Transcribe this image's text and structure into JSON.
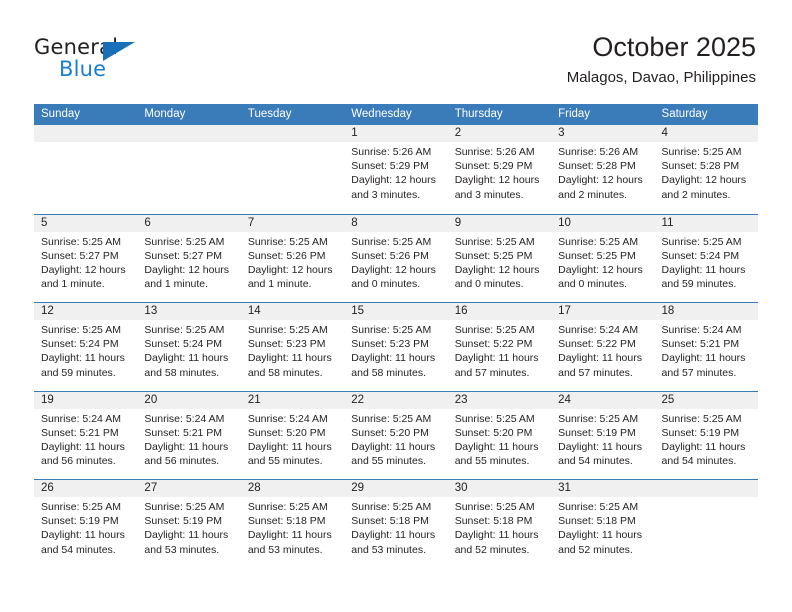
{
  "brand": {
    "name_part1": "General",
    "name_part2": "Blue",
    "triangle_icon": "triangle-icon",
    "color_dark": "#231f20",
    "color_blue": "#1a7fd4"
  },
  "header": {
    "title": "October 2025",
    "subtitle": "Malagos, Davao, Philippines"
  },
  "calendar": {
    "accent_color": "#3a7cba",
    "daynum_bg": "#f0f0f0",
    "weekday_headers": [
      "Sunday",
      "Monday",
      "Tuesday",
      "Wednesday",
      "Thursday",
      "Friday",
      "Saturday"
    ],
    "weeks": [
      [
        {
          "day": "",
          "sunrise": "",
          "sunset": "",
          "daylight_line1": "",
          "daylight_line2": ""
        },
        {
          "day": "",
          "sunrise": "",
          "sunset": "",
          "daylight_line1": "",
          "daylight_line2": ""
        },
        {
          "day": "",
          "sunrise": "",
          "sunset": "",
          "daylight_line1": "",
          "daylight_line2": ""
        },
        {
          "day": "1",
          "sunrise": "Sunrise: 5:26 AM",
          "sunset": "Sunset: 5:29 PM",
          "daylight_line1": "Daylight: 12 hours",
          "daylight_line2": "and 3 minutes."
        },
        {
          "day": "2",
          "sunrise": "Sunrise: 5:26 AM",
          "sunset": "Sunset: 5:29 PM",
          "daylight_line1": "Daylight: 12 hours",
          "daylight_line2": "and 3 minutes."
        },
        {
          "day": "3",
          "sunrise": "Sunrise: 5:26 AM",
          "sunset": "Sunset: 5:28 PM",
          "daylight_line1": "Daylight: 12 hours",
          "daylight_line2": "and 2 minutes."
        },
        {
          "day": "4",
          "sunrise": "Sunrise: 5:25 AM",
          "sunset": "Sunset: 5:28 PM",
          "daylight_line1": "Daylight: 12 hours",
          "daylight_line2": "and 2 minutes."
        }
      ],
      [
        {
          "day": "5",
          "sunrise": "Sunrise: 5:25 AM",
          "sunset": "Sunset: 5:27 PM",
          "daylight_line1": "Daylight: 12 hours",
          "daylight_line2": "and 1 minute."
        },
        {
          "day": "6",
          "sunrise": "Sunrise: 5:25 AM",
          "sunset": "Sunset: 5:27 PM",
          "daylight_line1": "Daylight: 12 hours",
          "daylight_line2": "and 1 minute."
        },
        {
          "day": "7",
          "sunrise": "Sunrise: 5:25 AM",
          "sunset": "Sunset: 5:26 PM",
          "daylight_line1": "Daylight: 12 hours",
          "daylight_line2": "and 1 minute."
        },
        {
          "day": "8",
          "sunrise": "Sunrise: 5:25 AM",
          "sunset": "Sunset: 5:26 PM",
          "daylight_line1": "Daylight: 12 hours",
          "daylight_line2": "and 0 minutes."
        },
        {
          "day": "9",
          "sunrise": "Sunrise: 5:25 AM",
          "sunset": "Sunset: 5:25 PM",
          "daylight_line1": "Daylight: 12 hours",
          "daylight_line2": "and 0 minutes."
        },
        {
          "day": "10",
          "sunrise": "Sunrise: 5:25 AM",
          "sunset": "Sunset: 5:25 PM",
          "daylight_line1": "Daylight: 12 hours",
          "daylight_line2": "and 0 minutes."
        },
        {
          "day": "11",
          "sunrise": "Sunrise: 5:25 AM",
          "sunset": "Sunset: 5:24 PM",
          "daylight_line1": "Daylight: 11 hours",
          "daylight_line2": "and 59 minutes."
        }
      ],
      [
        {
          "day": "12",
          "sunrise": "Sunrise: 5:25 AM",
          "sunset": "Sunset: 5:24 PM",
          "daylight_line1": "Daylight: 11 hours",
          "daylight_line2": "and 59 minutes."
        },
        {
          "day": "13",
          "sunrise": "Sunrise: 5:25 AM",
          "sunset": "Sunset: 5:24 PM",
          "daylight_line1": "Daylight: 11 hours",
          "daylight_line2": "and 58 minutes."
        },
        {
          "day": "14",
          "sunrise": "Sunrise: 5:25 AM",
          "sunset": "Sunset: 5:23 PM",
          "daylight_line1": "Daylight: 11 hours",
          "daylight_line2": "and 58 minutes."
        },
        {
          "day": "15",
          "sunrise": "Sunrise: 5:25 AM",
          "sunset": "Sunset: 5:23 PM",
          "daylight_line1": "Daylight: 11 hours",
          "daylight_line2": "and 58 minutes."
        },
        {
          "day": "16",
          "sunrise": "Sunrise: 5:25 AM",
          "sunset": "Sunset: 5:22 PM",
          "daylight_line1": "Daylight: 11 hours",
          "daylight_line2": "and 57 minutes."
        },
        {
          "day": "17",
          "sunrise": "Sunrise: 5:24 AM",
          "sunset": "Sunset: 5:22 PM",
          "daylight_line1": "Daylight: 11 hours",
          "daylight_line2": "and 57 minutes."
        },
        {
          "day": "18",
          "sunrise": "Sunrise: 5:24 AM",
          "sunset": "Sunset: 5:21 PM",
          "daylight_line1": "Daylight: 11 hours",
          "daylight_line2": "and 57 minutes."
        }
      ],
      [
        {
          "day": "19",
          "sunrise": "Sunrise: 5:24 AM",
          "sunset": "Sunset: 5:21 PM",
          "daylight_line1": "Daylight: 11 hours",
          "daylight_line2": "and 56 minutes."
        },
        {
          "day": "20",
          "sunrise": "Sunrise: 5:24 AM",
          "sunset": "Sunset: 5:21 PM",
          "daylight_line1": "Daylight: 11 hours",
          "daylight_line2": "and 56 minutes."
        },
        {
          "day": "21",
          "sunrise": "Sunrise: 5:24 AM",
          "sunset": "Sunset: 5:20 PM",
          "daylight_line1": "Daylight: 11 hours",
          "daylight_line2": "and 55 minutes."
        },
        {
          "day": "22",
          "sunrise": "Sunrise: 5:25 AM",
          "sunset": "Sunset: 5:20 PM",
          "daylight_line1": "Daylight: 11 hours",
          "daylight_line2": "and 55 minutes."
        },
        {
          "day": "23",
          "sunrise": "Sunrise: 5:25 AM",
          "sunset": "Sunset: 5:20 PM",
          "daylight_line1": "Daylight: 11 hours",
          "daylight_line2": "and 55 minutes."
        },
        {
          "day": "24",
          "sunrise": "Sunrise: 5:25 AM",
          "sunset": "Sunset: 5:19 PM",
          "daylight_line1": "Daylight: 11 hours",
          "daylight_line2": "and 54 minutes."
        },
        {
          "day": "25",
          "sunrise": "Sunrise: 5:25 AM",
          "sunset": "Sunset: 5:19 PM",
          "daylight_line1": "Daylight: 11 hours",
          "daylight_line2": "and 54 minutes."
        }
      ],
      [
        {
          "day": "26",
          "sunrise": "Sunrise: 5:25 AM",
          "sunset": "Sunset: 5:19 PM",
          "daylight_line1": "Daylight: 11 hours",
          "daylight_line2": "and 54 minutes."
        },
        {
          "day": "27",
          "sunrise": "Sunrise: 5:25 AM",
          "sunset": "Sunset: 5:19 PM",
          "daylight_line1": "Daylight: 11 hours",
          "daylight_line2": "and 53 minutes."
        },
        {
          "day": "28",
          "sunrise": "Sunrise: 5:25 AM",
          "sunset": "Sunset: 5:18 PM",
          "daylight_line1": "Daylight: 11 hours",
          "daylight_line2": "and 53 minutes."
        },
        {
          "day": "29",
          "sunrise": "Sunrise: 5:25 AM",
          "sunset": "Sunset: 5:18 PM",
          "daylight_line1": "Daylight: 11 hours",
          "daylight_line2": "and 53 minutes."
        },
        {
          "day": "30",
          "sunrise": "Sunrise: 5:25 AM",
          "sunset": "Sunset: 5:18 PM",
          "daylight_line1": "Daylight: 11 hours",
          "daylight_line2": "and 52 minutes."
        },
        {
          "day": "31",
          "sunrise": "Sunrise: 5:25 AM",
          "sunset": "Sunset: 5:18 PM",
          "daylight_line1": "Daylight: 11 hours",
          "daylight_line2": "and 52 minutes."
        },
        {
          "day": "",
          "sunrise": "",
          "sunset": "",
          "daylight_line1": "",
          "daylight_line2": ""
        }
      ]
    ]
  }
}
